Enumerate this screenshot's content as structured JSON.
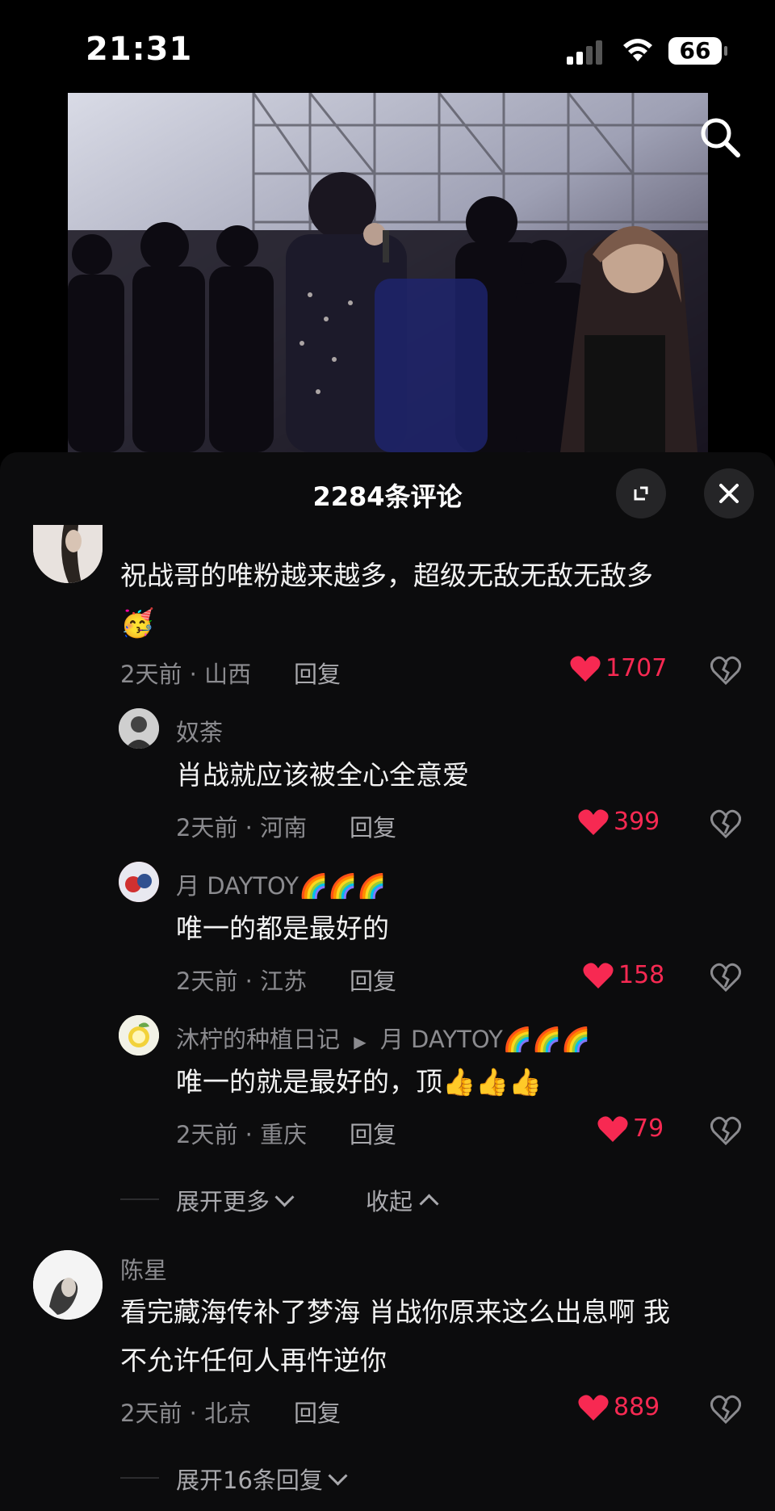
{
  "status": {
    "time": "21:31",
    "battery": "66"
  },
  "sheet": {
    "title": "2284条评论"
  },
  "comments": [
    {
      "text": "祝战哥的唯粉越来越多，超级无敌无敌无敌多",
      "emoji": "🥳",
      "meta": "2天前 · 山西",
      "reply": "回复",
      "likes": "1707"
    },
    {
      "name": "奴荼",
      "text": "肖战就应该被全心全意爱",
      "meta": "2天前 · 河南",
      "reply": "回复",
      "likes": "399"
    },
    {
      "name": "月 DAYTOY🌈🌈🌈",
      "text": "唯一的都是最好的",
      "meta": "2天前 · 江苏",
      "reply": "回复",
      "likes": "158"
    },
    {
      "name": "沐柠的种植日记",
      "reply_to": "月 DAYTOY🌈🌈🌈",
      "text": "唯一的就是最好的，顶👍👍👍",
      "meta": "2天前 · 重庆",
      "reply": "回复",
      "likes": "79"
    },
    {
      "name": "陈星",
      "text_line1": "看完藏海传补了梦海 肖战你原来这么出息啊 我",
      "text_line2": "不允许任何人再忤逆你",
      "meta": "2天前 · 北京",
      "reply": "回复",
      "likes": "889"
    }
  ],
  "expand_more": "展开更多",
  "collapse": "收起",
  "expand_replies": "展开16条回复"
}
